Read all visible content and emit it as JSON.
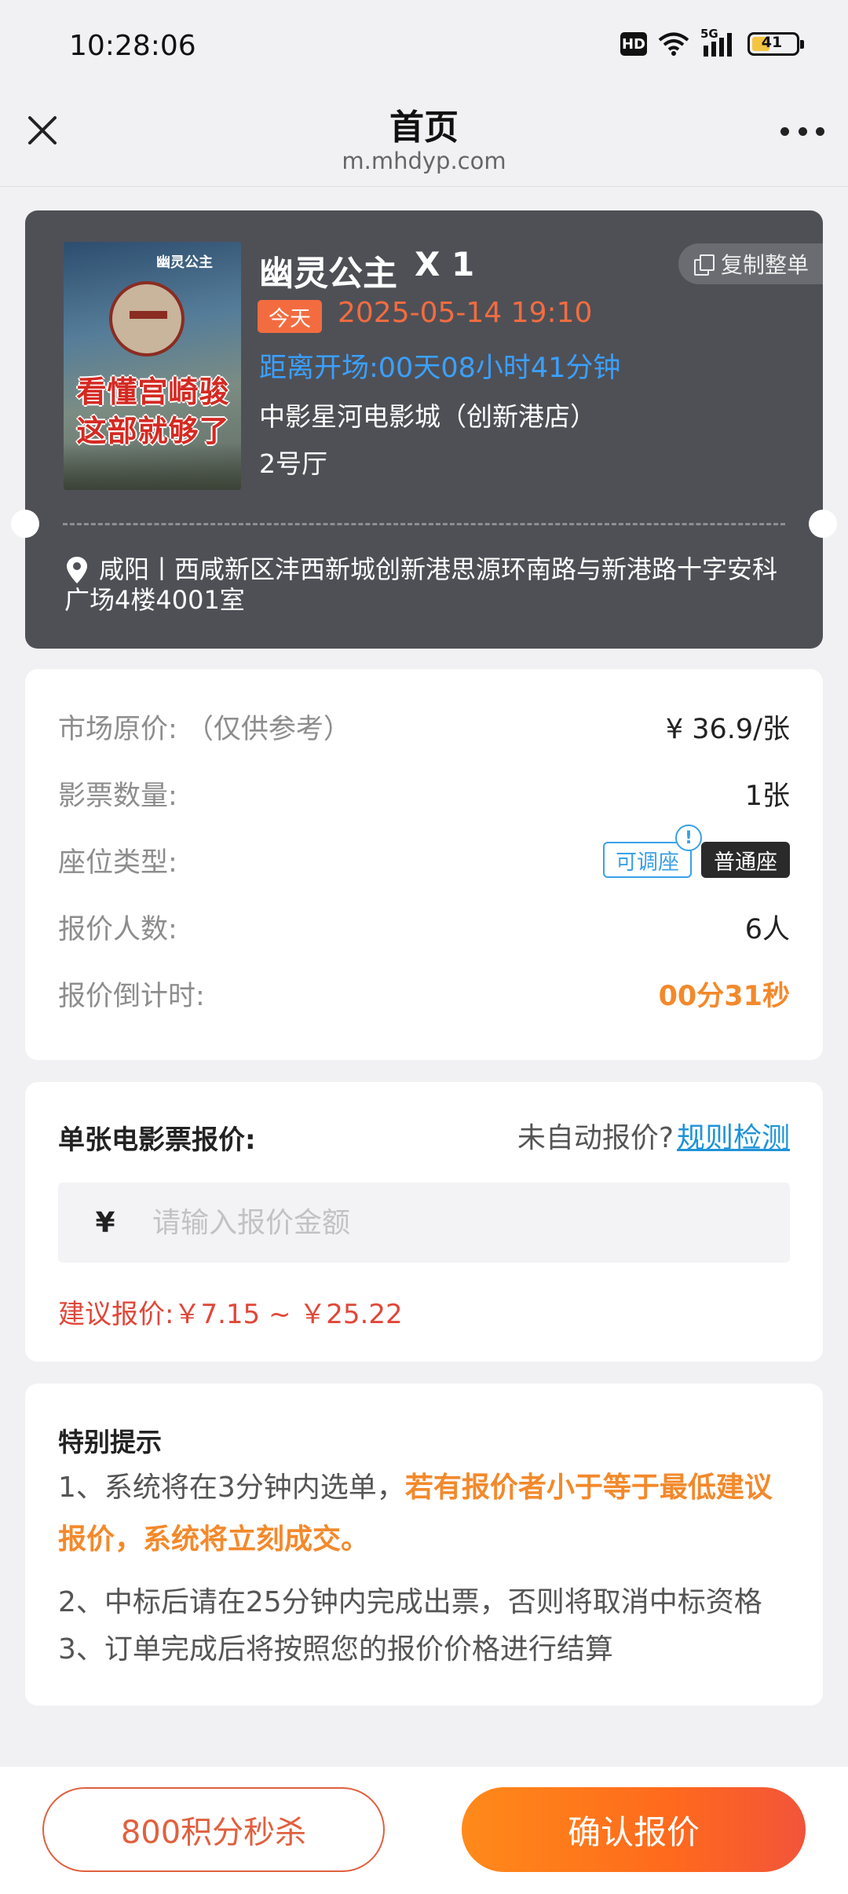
{
  "status_bar": {
    "time": "10:28:06",
    "hd": "HD",
    "network": "5G",
    "battery": "41"
  },
  "nav": {
    "title": "首页",
    "url": "m.mhdyp.com",
    "close_icon": "close-icon",
    "more_icon": "more-icon"
  },
  "movie": {
    "poster_text": {
      "logo": "幽灵公主",
      "line1": "看懂宫崎骏",
      "line2": "这部就够了"
    },
    "title": "幽灵公主",
    "quantity": "X 1",
    "copy_label": "复制整单",
    "today_badge": "今天",
    "showtime": "2025-05-14 19:10",
    "countdown": "距离开场:00天08小时41分钟",
    "cinema": "中影星河电影城（创新港店）",
    "hall": "2号厅",
    "address": "咸阳丨西咸新区沣西新城创新港思源环南路与新港路十字安科广场4楼4001室"
  },
  "info": {
    "rows": [
      {
        "label": "市场原价: （仅供参考）",
        "value": "¥ 36.9/张"
      },
      {
        "label": "影票数量:",
        "value": "1张"
      },
      {
        "label": "座位类型:",
        "value": ""
      },
      {
        "label": "报价人数:",
        "value": "6人"
      },
      {
        "label": "报价倒计时:",
        "value": "00分31秒"
      }
    ],
    "seat_tag_adjustable": "可调座",
    "seat_tag_normal": "普通座",
    "info_glyph": "!"
  },
  "bid": {
    "label": "单张电影票报价:",
    "no_auto": "未自动报价?",
    "rule_link": "规则检测",
    "currency": "¥",
    "placeholder": "请输入报价金额",
    "value": "",
    "suggest": "建议报价:￥7.15 ~ ￥25.22"
  },
  "notice": {
    "title": "特别提示",
    "line1_prefix": "1、系统将在3分钟内选单，",
    "line1_highlight": "若有报价者小于等于最低建议报价，系统将立刻成交。",
    "line2": "2、中标后请在25分钟内完成出票，否则将取消中标资格",
    "line3": "3、订单完成后将按照您的报价价格进行结算"
  },
  "actions": {
    "flash_sale": "800积分秒杀",
    "confirm": "确认报价"
  },
  "colors": {
    "accent_orange": "#f3892b",
    "badge_orange": "#f36c40",
    "link_blue": "#1f93d8",
    "countdown_blue": "#3aa0ff",
    "suggest_red": "#e0473a"
  }
}
